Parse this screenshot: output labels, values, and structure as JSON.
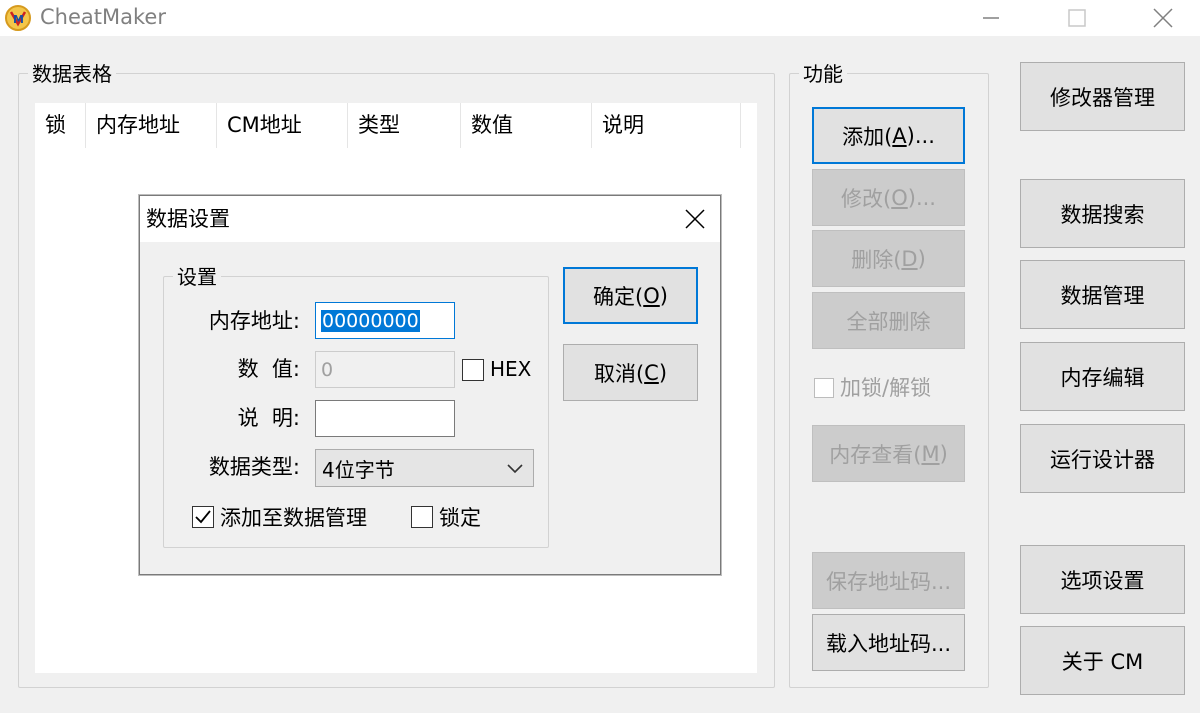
{
  "window": {
    "title": "CheatMaker",
    "icon": "cheatmaker-logo-icon",
    "controls": [
      "minimize-icon",
      "maximize-icon",
      "close-icon"
    ]
  },
  "data_table": {
    "group_label": "数据表格",
    "columns": [
      "锁",
      "内存地址",
      "CM地址",
      "类型",
      "数值",
      "说明"
    ],
    "rows": []
  },
  "functions": {
    "group_label": "功能",
    "add": {
      "text": "添加(",
      "key": "A",
      "suffix": ")..."
    },
    "modify": {
      "text": "修改(",
      "key": "O",
      "suffix": ")..."
    },
    "delete": {
      "text": "删除(",
      "key": "D",
      "suffix": ")"
    },
    "delete_all": "全部删除",
    "lock_toggle": "加锁/解锁",
    "memory_view": {
      "text": "内存查看(",
      "key": "M",
      "suffix": ")"
    },
    "save_codes": "保存地址码...",
    "load_codes": "载入地址码..."
  },
  "right_panel": {
    "modifier_manager": "修改器管理",
    "data_search": "数据搜索",
    "data_manager": "数据管理",
    "memory_editor": "内存编辑",
    "run_designer": "运行设计器",
    "options": "选项设置",
    "about": "关于 CM"
  },
  "dialog": {
    "title": "数据设置",
    "group_label": "设置",
    "address_label": "内存地址:",
    "address_value": "00000000",
    "value_label": "数  值:",
    "value_value": "0",
    "hex_label": "HEX",
    "desc_label": "说  明:",
    "desc_value": "",
    "type_label": "数据类型:",
    "type_value": "4位字节",
    "add_to_manager_label": "添加至数据管理",
    "add_to_manager_checked": true,
    "lock_label": "锁定",
    "lock_checked": false,
    "ok": {
      "text": "确定(",
      "key": "O",
      "suffix": ")"
    },
    "cancel": {
      "text": "取消(",
      "key": "C",
      "suffix": ")"
    }
  }
}
